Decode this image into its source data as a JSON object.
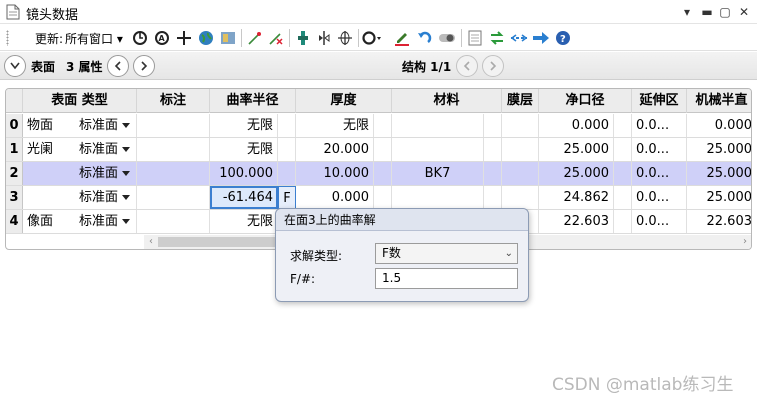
{
  "window": {
    "title": "镜头数据"
  },
  "toolbar": {
    "update_label": "更新:",
    "update_value": "所有窗口",
    "icons": [
      "refresh-icon",
      "auto-refresh-icon",
      "crosshair-icon",
      "globe-icon",
      "layout-icon",
      "lens-wand-icon",
      "wand-off-icon",
      "slider-icon",
      "flip-icon",
      "axis-icon",
      "ring-icon",
      "pen-ok-icon",
      "undo-icon",
      "toggle-icon",
      "page-icon",
      "arrows-swap-icon",
      "dots-arrow-icon",
      "arrow-right-icon",
      "help-icon"
    ]
  },
  "nav": {
    "surface_label": "表面",
    "properties_label": "3 属性",
    "config_label": "结构 1/1"
  },
  "table": {
    "headers": [
      "表面 类型",
      "标注",
      "曲率半径",
      "厚度",
      "材料",
      "膜层",
      "净口径",
      "延伸区",
      "机械半直"
    ],
    "rows": [
      {
        "num": "0",
        "name": "物面",
        "type": "标准面",
        "comment": "",
        "radius": "无限",
        "thickness": "无限",
        "material": "",
        "coating": "",
        "clear": "0.000",
        "ext": "0.0...",
        "mech": "0.000"
      },
      {
        "num": "1",
        "name": "光阑",
        "type": "标准面",
        "comment": "",
        "radius": "无限",
        "thickness": "20.000",
        "material": "",
        "coating": "",
        "clear": "25.000",
        "ext": "0.0...",
        "mech": "25.000"
      },
      {
        "num": "2",
        "name": "",
        "type": "标准面",
        "comment": "",
        "radius": "100.000",
        "thickness": "10.000",
        "material": "BK7",
        "coating": "",
        "clear": "25.000",
        "ext": "0.0...",
        "mech": "25.000"
      },
      {
        "num": "3",
        "name": "",
        "type": "标准面",
        "comment": "",
        "radius": "-61.464",
        "solve": "F",
        "thickness": "0.000",
        "material": "",
        "coating": "",
        "clear": "24.862",
        "ext": "0.0...",
        "mech": "25.000"
      },
      {
        "num": "4",
        "name": "像面",
        "type": "标准面",
        "comment": "",
        "radius": "无限",
        "thickness": "",
        "material": "",
        "coating": "",
        "clear": "22.603",
        "ext": "0.0...",
        "mech": "22.603"
      }
    ]
  },
  "popup": {
    "title": "在面3上的曲率解",
    "solve_type_label": "求解类型:",
    "solve_type_value": "F数",
    "fnum_label": "F/#:",
    "fnum_value": "1.5"
  },
  "watermark": "CSDN @matlab练习生",
  "colors": {
    "selected_row": "#cfd0f8",
    "edit_outline": "#3c7fd0"
  }
}
